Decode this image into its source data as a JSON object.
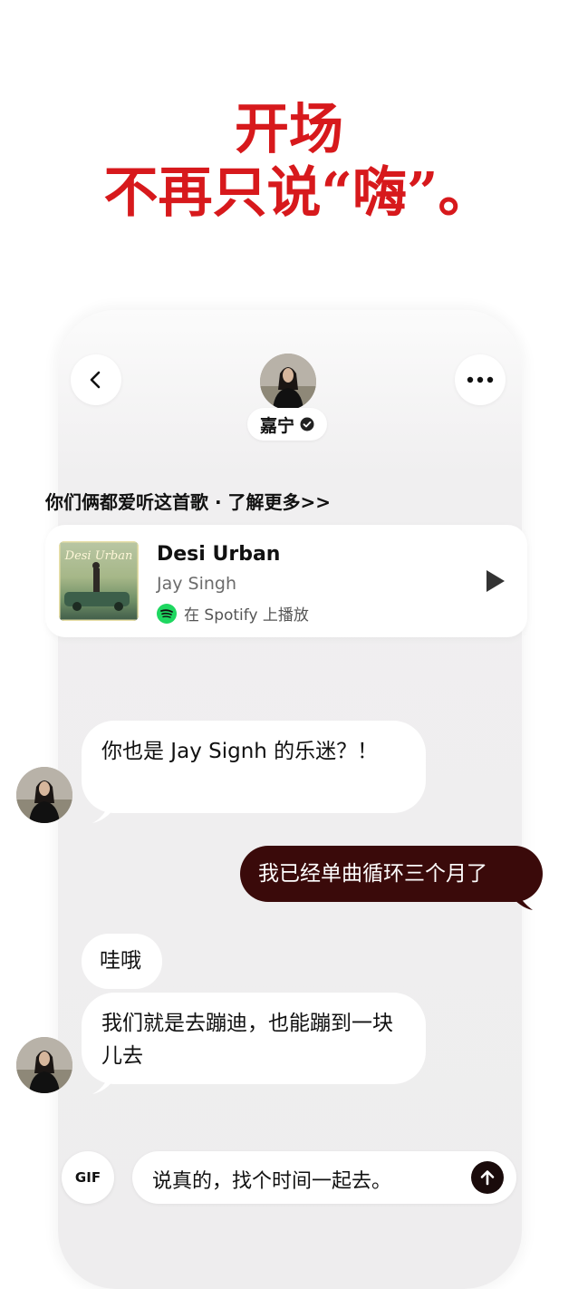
{
  "headline": {
    "line1": "开场",
    "line2": "不再只说“嗨”。"
  },
  "header": {
    "name": "嘉宁"
  },
  "shared_music": {
    "label": "你们俩都爱听这首歌 · 了解更多>>",
    "song": {
      "title": "Desi Urban",
      "artist": "Jay Singh",
      "platform_text": "在 Spotify 上播放",
      "cover_text": "Desi Urban"
    }
  },
  "messages": [
    {
      "side": "left",
      "text": "你也是 Jay Signh 的乐迷？！"
    },
    {
      "side": "right",
      "text": "我已经单曲循环三个月了"
    },
    {
      "side": "left",
      "text": "哇哦"
    },
    {
      "side": "left",
      "text": "我们就是去蹦迪，也能蹦到一块儿去"
    }
  ],
  "composer": {
    "gif_label": "GIF",
    "draft_text": "说真的，找个时间一起去。"
  },
  "colors": {
    "headline_red": "#d7191c",
    "sent_bubble": "#3a0a0a",
    "spotify_green": "#1ed760"
  },
  "icons": {
    "back": "chevron-left-icon",
    "more": "more-dots-icon",
    "verified": "verified-badge-icon",
    "play": "play-icon",
    "spotify": "spotify-icon",
    "send": "arrow-up-icon"
  }
}
